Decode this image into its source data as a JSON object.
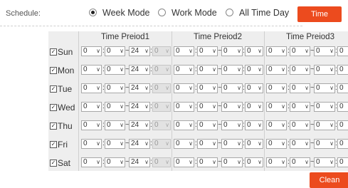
{
  "schedule": {
    "label": "Schedule:",
    "modes": [
      {
        "label": "Week Mode",
        "selected": true
      },
      {
        "label": "Work Mode",
        "selected": false
      },
      {
        "label": "All Time Day",
        "selected": false
      }
    ],
    "time_button": "Time",
    "accent_color": "#ec4b1e"
  },
  "table": {
    "periods": [
      "Time Preiod1",
      "Time Preiod2",
      "Time Preiod3"
    ],
    "days": [
      {
        "label": "Sun",
        "checked": true
      },
      {
        "label": "Mon",
        "checked": true
      },
      {
        "label": "Tue",
        "checked": true
      },
      {
        "label": "Wed",
        "checked": true
      },
      {
        "label": "Thu",
        "checked": true
      },
      {
        "label": "Fri",
        "checked": true
      },
      {
        "label": "Sat",
        "checked": true
      }
    ],
    "period1": {
      "start_hour": "0",
      "start_min": "0",
      "sep": "~",
      "end_hour": "24",
      "end_min": "0"
    },
    "period_other": {
      "start_hour": "0",
      "start_min": "0",
      "sep": "~",
      "end_hour": "0",
      "end_min": "0"
    },
    "colon": ":"
  },
  "clean_button": "Clean"
}
